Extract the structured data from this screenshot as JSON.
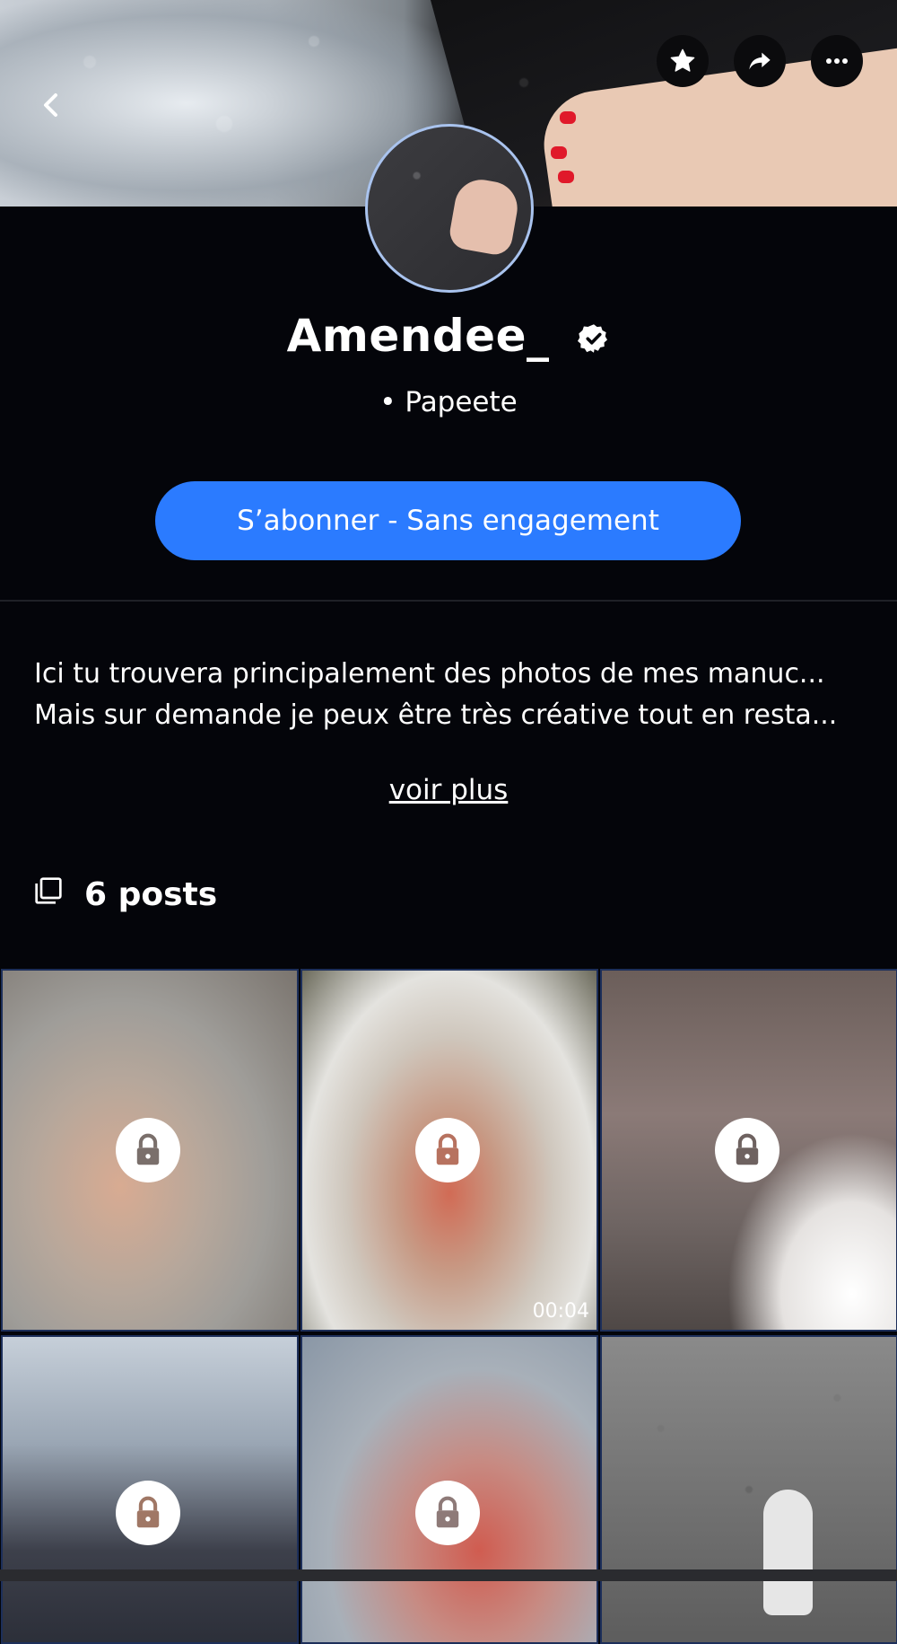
{
  "header": {
    "back_icon": "chevron-left-icon",
    "actions": [
      {
        "icon": "star-icon"
      },
      {
        "icon": "share-icon"
      },
      {
        "icon": "more-horizontal-icon"
      }
    ]
  },
  "profile": {
    "username": "Amendee_",
    "verified_icon": "verified-badge-icon",
    "location": "• Papeete"
  },
  "subscribe_button": {
    "label": "S’abonner - Sans engagement",
    "color": "#2b7bff"
  },
  "bio": {
    "line1": "Ici tu trouvera principalement des photos de mes manuc...",
    "line2": "Mais sur demande je peux être très créative tout en resta...",
    "more_label": "voir plus"
  },
  "posts_header": {
    "icon": "gallery-icon",
    "label": "6 posts"
  },
  "posts": [
    {
      "locked": true
    },
    {
      "locked": true,
      "duration": "00:04"
    },
    {
      "locked": true
    },
    {
      "locked": true
    },
    {
      "locked": true
    },
    {
      "locked": false
    }
  ],
  "colors": {
    "background": "#04050a",
    "accent": "#2b7bff"
  }
}
